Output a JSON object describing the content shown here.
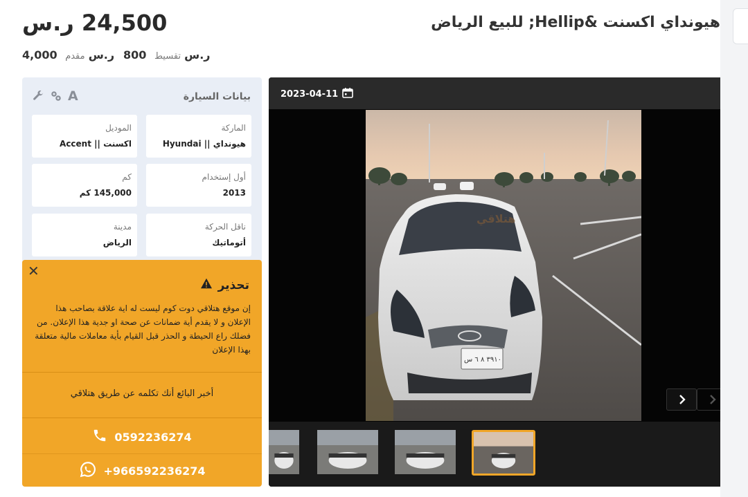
{
  "listing": {
    "price": "24,500 ر.س",
    "title": "هيونداي اكسنت &Hellip; للبيع الرياض",
    "installment_label": "تقسيط",
    "installment_value": "800 ر.س",
    "down_label": "مقدم",
    "down_value": "4,000 ر.س"
  },
  "car_data": {
    "title": "بيانات السيارة",
    "icons": [
      "wrench-icon",
      "cogs-icon",
      "font-icon"
    ],
    "fields": [
      {
        "label": "الماركة",
        "value": "هيونداي || Hyundai"
      },
      {
        "label": "الموديل",
        "value": "اكسنت || Accent"
      },
      {
        "label": "أول إستخدام",
        "value": "2013"
      },
      {
        "label": "كم",
        "value": "145,000 كم"
      },
      {
        "label": "ناقل الحركة",
        "value": "أتوماتيك"
      },
      {
        "label": "مدينة",
        "value": "الرياض"
      }
    ]
  },
  "warning": {
    "title": "تحذير",
    "text": "إن موقع هتلاقي دوت كوم ليست له اية علاقة بصاحب هذا الإعلان و لا يقدم أية ضمانات عن صحة او جدية هذا الإعلان. من فضلك راع الحيطة و الحذر قبل القيام بأية معاملات مالية متعلقة بهذا الإعلان",
    "tell_seller": "أخبر البائع أنك تكلمه عن طريق هتلاقي",
    "phone": "0592236274",
    "whatsapp": "+966592236274",
    "color": "#f1a628"
  },
  "gallery": {
    "date": "2023-04-11",
    "watermark": "هتلاقي",
    "plate": "٣٩١٠ ٨ ٦ س"
  }
}
